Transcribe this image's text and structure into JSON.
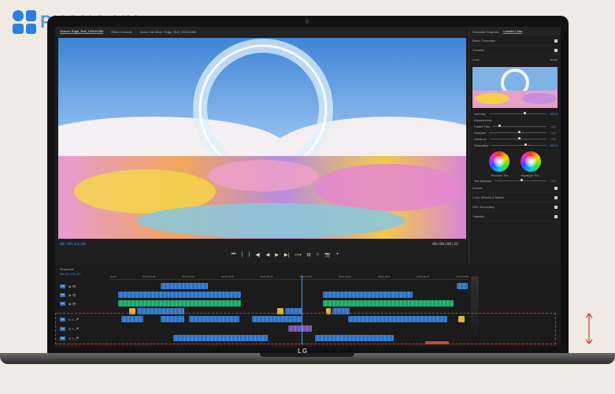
{
  "brand": {
    "logo_text": "PHONG VU",
    "laptop_brand": "LG"
  },
  "monitor": {
    "tabs": [
      "Source: Edge_Roll_1920x1080",
      "Effect Controls",
      "Audio Clip Mixer: Edge_Roll_1920x1080"
    ],
    "timecode_left": "00;00;13;20",
    "timecode_right": "00;00;09;22",
    "transport": [
      "⏮",
      "{",
      "}",
      "◀|",
      "◀",
      "▶",
      "▶|",
      "⟿",
      "⊟",
      "⌂",
      "📷",
      "+"
    ]
  },
  "lumetri": {
    "tabs": [
      "Essential Graphics",
      "Lumetri Color"
    ],
    "sections": [
      "Basic Correction",
      "Creative",
      "Curves",
      "Color Wheels & Match",
      "HSL Secondary",
      "Vignette"
    ],
    "look_label": "Look",
    "look_value": "None",
    "sliders": [
      {
        "label": "Intensity",
        "value": "100.0"
      },
      {
        "label": "Faded Film",
        "value": "0.0"
      },
      {
        "label": "Sharpen",
        "value": "0.0"
      },
      {
        "label": "Vibrance",
        "value": "0.0"
      },
      {
        "label": "Saturation",
        "value": "100.0"
      }
    ],
    "adjustments_label": "Adjustments",
    "wheel_labels": [
      "Shadow Tint",
      "Highlight Tint"
    ],
    "tint_balance_label": "Tint Balance",
    "tint_balance_value": "0.0"
  },
  "timeline": {
    "title": "Sequence",
    "timecode": "00;01;13;27",
    "ruler": [
      "00;00",
      "00;00;15;00",
      "00;00;30;00",
      "00;00;45;00",
      "00;01;00;00",
      "00;01;15;00",
      "00;01;30;00",
      "00;01;45;00",
      "00;02;00;00",
      "00;02;15;00"
    ],
    "tracks": [
      "V3",
      "V2",
      "V1",
      "A1",
      "A2",
      "A3"
    ]
  }
}
